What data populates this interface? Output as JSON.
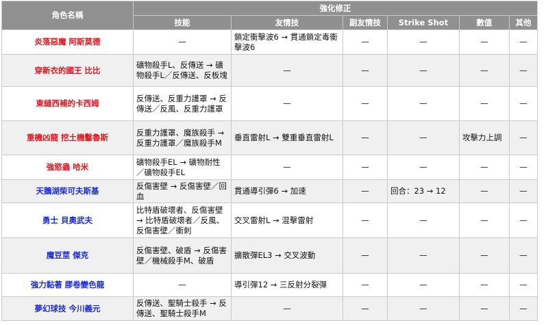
{
  "headers": {
    "role_name": "角色名稱",
    "enhance": "強化修正",
    "skill": "技能",
    "friend_skill": "友情技",
    "sub_friend_skill": "副友情技",
    "strike_shot": "Strike Shot",
    "stats": "數值",
    "other": "其他"
  },
  "colors": {
    "red_name": "#e8141e",
    "blue_name": "#1a2ce0",
    "header_bg": "#909090"
  },
  "rows": [
    {
      "name": "炎落惡魔 阿斯莫德",
      "skill": "—",
      "friend": "鎖定衝擊波6 → 貫通鎖定毒衝擊波6",
      "sub_friend": "—",
      "strike": "—",
      "stats": "—",
      "other": "—"
    },
    {
      "name": "穿新衣的國王 比比",
      "skill": "礦物殺手L、反傳送 → 礦物殺手L／反傳送、反板塊",
      "friend": "—",
      "sub_friend": "—",
      "strike": "—",
      "stats": "—",
      "other": "—"
    },
    {
      "name": "東縫西補的卡西姆",
      "skill": "反傳送、反重力護罩 → 反傳送／反風、反重力護罩",
      "friend": "—",
      "sub_friend": "—",
      "strike": "—",
      "stats": "—",
      "other": "—"
    },
    {
      "name": "重機凶龍 挖土機鑿魯斯",
      "skill": "反重力護罩、魔族殺手 → 反重力護罩／魔族殺手M",
      "friend": "垂直雷射L → 雙重垂直雷射L",
      "sub_friend": "—",
      "strike": "—",
      "stats": "攻擊力上調",
      "other": "—"
    },
    {
      "name": "強慾蟲 哈米",
      "skill": "礦物殺手EL → 礦物耐性／礦物殺手EL",
      "friend": "—",
      "sub_friend": "—",
      "strike": "—",
      "stats": "—",
      "other": "—"
    },
    {
      "name": "天鵝湖柴可夫斯基",
      "skill": "反傷害壁 → 反傷害壁／回血",
      "friend": "貫通導引彈6 → 加速",
      "sub_friend": "—",
      "strike": "回合：23 → 12",
      "stats": "—",
      "other": "—"
    },
    {
      "name": "勇士 貝奧武夫",
      "skill": "比特盾破壞者、反傷害壁 → 比特盾破壞者／反風、反傷害壁／衝刺",
      "friend": "交叉雷射L → 混擊雷射",
      "sub_friend": "—",
      "strike": "—",
      "stats": "—",
      "other": "—"
    },
    {
      "name": "魔豆莖 傑克",
      "skill": "反傷害壁、破盾 → 反傷害壁／機械殺手M、破盾",
      "friend": "擴散彈EL3 → 交叉波動",
      "sub_friend": "—",
      "strike": "—",
      "stats": "—",
      "other": "—"
    },
    {
      "name": "強力黏著 膠卷變色龍",
      "skill": "—",
      "friend": "導引彈12 → 三反射分裂彈",
      "sub_friend": "—",
      "strike": "—",
      "stats": "—",
      "other": "—"
    },
    {
      "name": "夢幻球技 今川義元",
      "skill": "反傳送、聖騎士殺手 → 反傳送、聖騎士殺手M",
      "friend": "—",
      "sub_friend": "—",
      "strike": "—",
      "stats": "—",
      "other": "—"
    }
  ]
}
